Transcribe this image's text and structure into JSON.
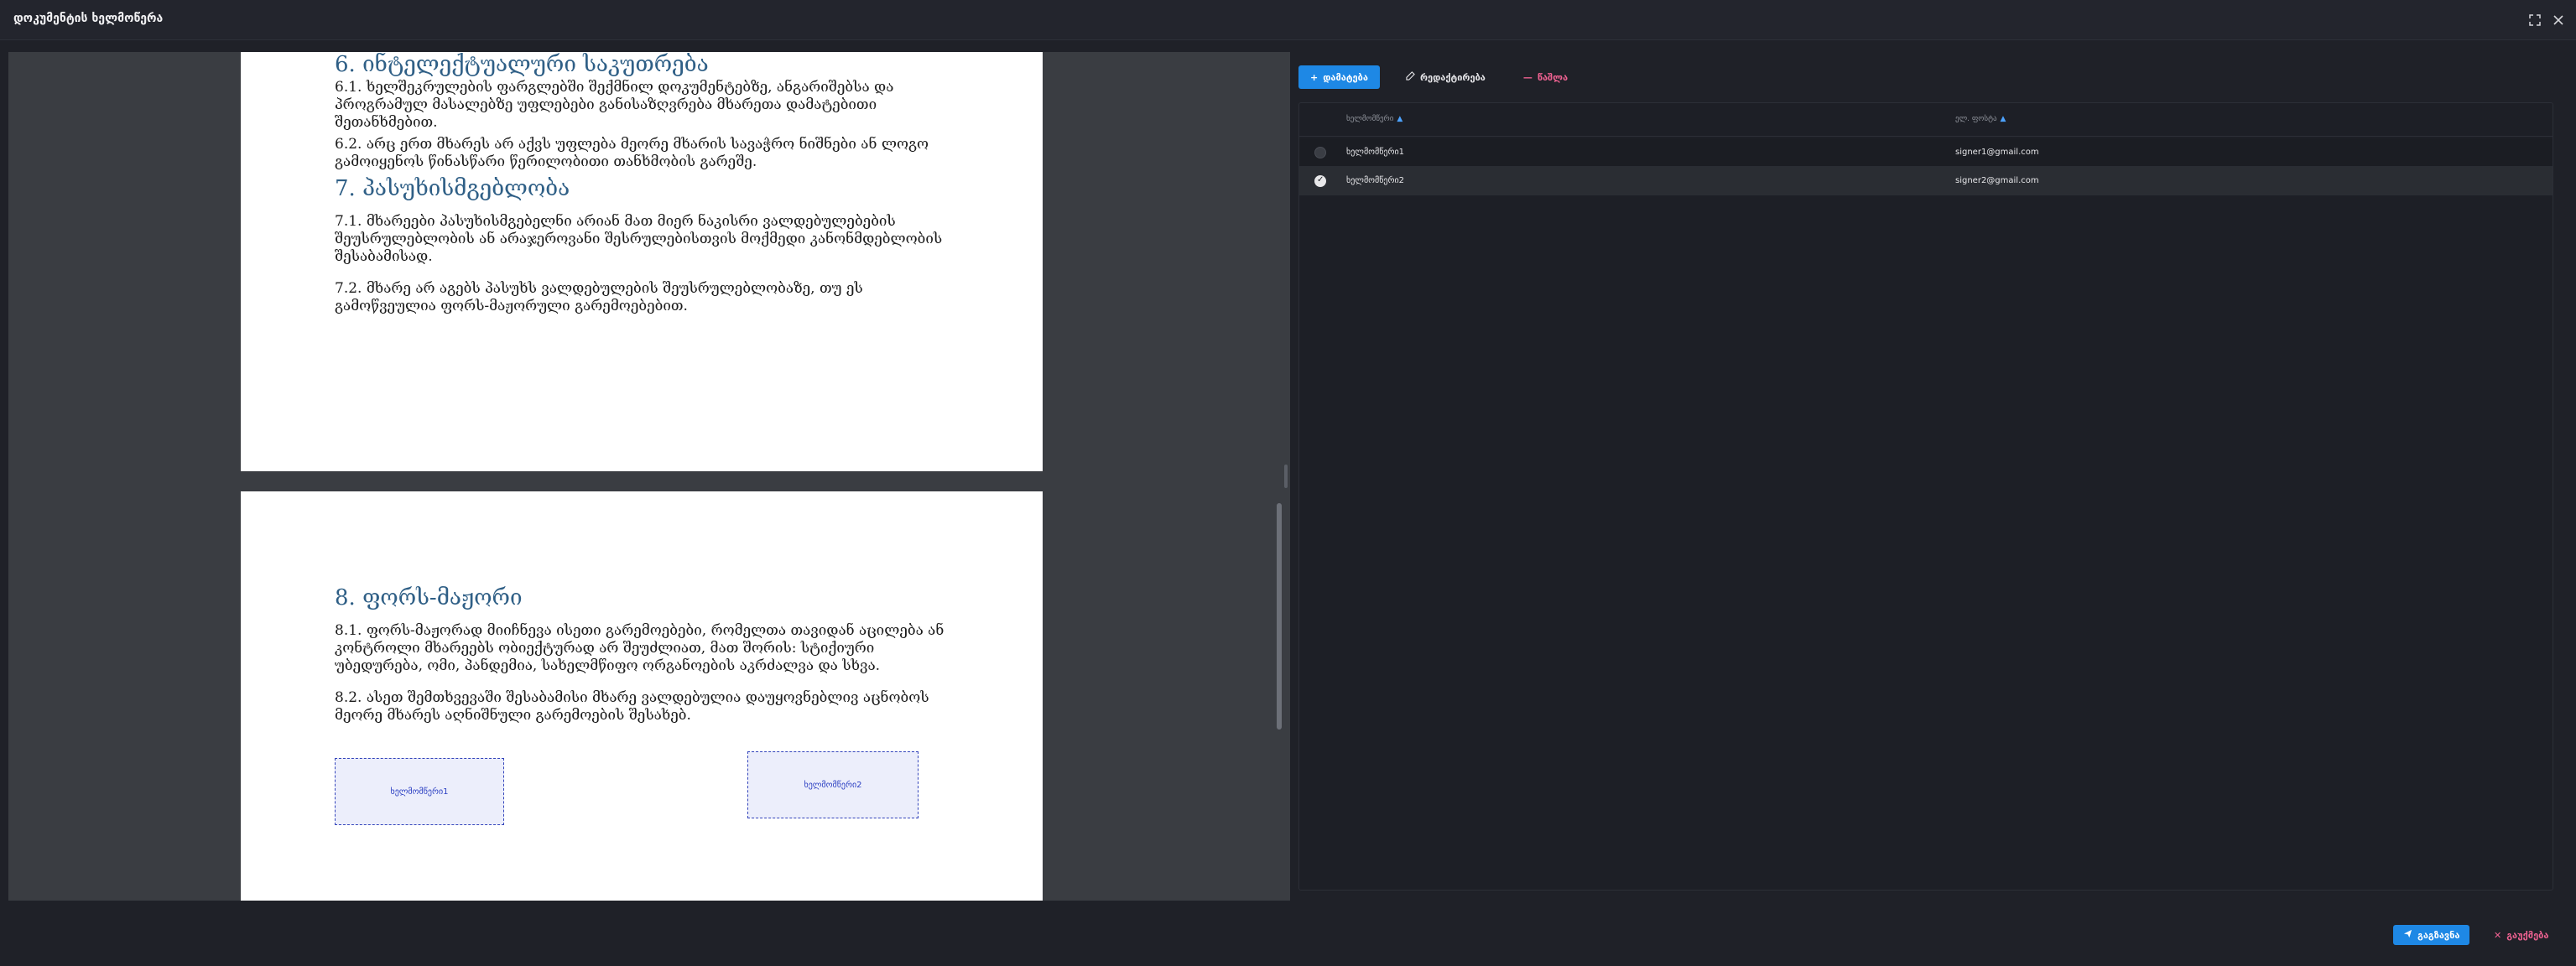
{
  "window": {
    "title": "დოკუმენტის ხელმოწერა",
    "expand_icon": "expand-icon",
    "close_icon": "close-icon"
  },
  "document": {
    "page1": {
      "heading6": "6. ინტელექტუალური საკუთრება",
      "p6_1": "6.1. ხელშეკრულების ფარგლებში შექმნილ დოკუმენტებზე, ანგარიშებსა და პროგრამულ მასალებზე უფლებები განისაზღვრება მხარეთა დამატებითი შეთანხმებით.",
      "p6_2": "6.2. არც ერთ მხარეს არ აქვს უფლება მეორე მხარის სავაჭრო ნიშნები ან ლოგო გამოიყენოს წინასწარი წერილობითი თანხმობის გარეშე.",
      "heading7": "7. პასუხისმგებლობა",
      "p7_1": "7.1. მხარეები პასუხისმგებელნი არიან მათ მიერ ნაკისრი ვალდებულებების შეუსრულებლობის ან არაჯეროვანი შესრულებისთვის მოქმედი კანონმდებლობის შესაბამისად.",
      "p7_2": "7.2. მხარე არ აგებს პასუხს ვალდებულების შეუსრულებლობაზე, თუ ეს გამოწვეულია ფორს-მაჟორული გარემოებებით."
    },
    "page2": {
      "heading8": "8. ფორს-მაჟორი",
      "p8_1": "8.1. ფორს-მაჟორად მიიჩნევა ისეთი გარემოებები, რომელთა თავიდან აცილება ან კონტროლი მხარეებს ობიექტურად არ შეუძლიათ, მათ შორის: სტიქიური უბედურება, ომი, პანდემია, სახელმწიფო ორგანოების აკრძალვა და სხვა.",
      "p8_2": "8.2. ასეთ შემთხვევაში შესაბამისი მხარე ვალდებულია დაუყოვნებლივ აცნობოს მეორე მხარეს აღნიშნული გარემოების შესახებ.",
      "sig1_label": "ხელმომწერი1",
      "sig2_label": "ხელმომწერი2"
    }
  },
  "toolbar": {
    "add_label": "დამატება",
    "edit_label": "რედაქტირება",
    "delete_label": "წაშლა"
  },
  "table": {
    "col_signer": "ხელმომწერი",
    "col_email": "ელ. ფოსტა",
    "rows": [
      {
        "signer": "ხელმომწერი1",
        "email": "signer1@gmail.com",
        "selected": false
      },
      {
        "signer": "ხელმომწერი2",
        "email": "signer2@gmail.com",
        "selected": true
      }
    ]
  },
  "footer": {
    "send_label": "გაგზავნა",
    "cancel_label": "გაუქმება"
  },
  "colors": {
    "accent": "#1e88e5",
    "danger": "#f06292",
    "heading": "#2f5f86"
  }
}
